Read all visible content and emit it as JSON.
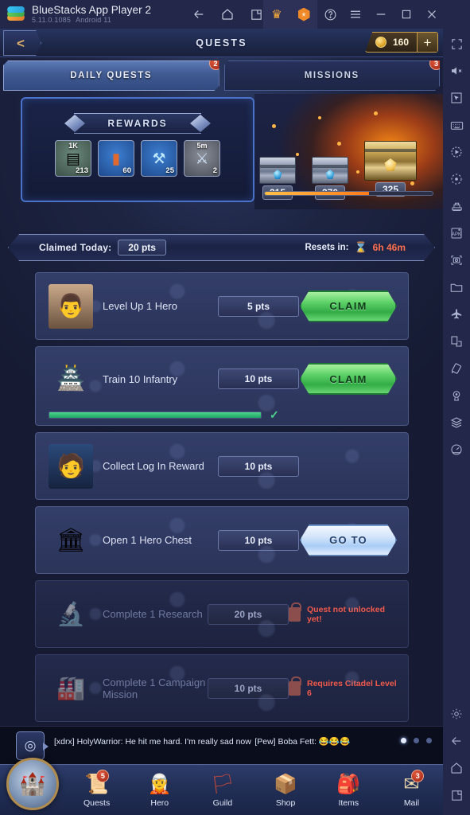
{
  "titlebar": {
    "app_name": "BlueStacks App Player 2",
    "version": "5.11.0.1085",
    "android": "Android 11",
    "nav": [
      {
        "name": "back-icon",
        "label": "Back"
      },
      {
        "name": "home-icon",
        "label": "Home"
      },
      {
        "name": "multi-instance-icon",
        "label": "Multi-instance"
      }
    ],
    "actions": [
      {
        "name": "crown-icon",
        "label": "Premium"
      },
      {
        "name": "shield-icon",
        "label": "Shield"
      },
      {
        "name": "help-icon",
        "label": "Help"
      },
      {
        "name": "menu-icon",
        "label": "Menu"
      },
      {
        "name": "minimize-icon",
        "label": "Minimize"
      },
      {
        "name": "maximize-icon",
        "label": "Maximize"
      },
      {
        "name": "close-icon",
        "label": "Close"
      },
      {
        "name": "collapse-icon",
        "label": "Collapse"
      }
    ]
  },
  "sidebar": {
    "items": [
      {
        "name": "fullscreen-icon",
        "label": "Fullscreen"
      },
      {
        "name": "mute-icon",
        "label": "Mute"
      },
      {
        "name": "cursor-icon",
        "label": "Pointer"
      },
      {
        "name": "keyboard-icon",
        "label": "Keyboard controls"
      },
      {
        "name": "macro-record-icon",
        "label": "Macro recorder"
      },
      {
        "name": "script-icon",
        "label": "Script"
      },
      {
        "name": "eco-mode-icon",
        "label": "Eco mode"
      },
      {
        "name": "install-apk-icon",
        "label": "Install APK"
      },
      {
        "name": "screenshot-icon",
        "label": "Screenshot"
      },
      {
        "name": "media-folder-icon",
        "label": "Media manager"
      },
      {
        "name": "airplane-icon",
        "label": "Game controls"
      },
      {
        "name": "rotate-icon",
        "label": "Rotate"
      },
      {
        "name": "shake-icon",
        "label": "Shake"
      },
      {
        "name": "location-icon",
        "label": "Location"
      },
      {
        "name": "layers-icon",
        "label": "Layers"
      },
      {
        "name": "gauge-icon",
        "label": "Performance"
      }
    ],
    "bottom_items": [
      {
        "name": "settings-gear-icon",
        "label": "Settings"
      },
      {
        "name": "android-back-icon",
        "label": "Back"
      },
      {
        "name": "android-home-icon",
        "label": "Home"
      },
      {
        "name": "android-recents-icon",
        "label": "Recents"
      }
    ]
  },
  "game": {
    "header": {
      "title": "QUESTS",
      "back_label": "<",
      "currency_value": "160",
      "currency_add": "+"
    },
    "tabs": [
      {
        "label": "DAILY QUESTS",
        "badge": "2",
        "active": true
      },
      {
        "label": "MISSIONS",
        "badge": "3",
        "active": false
      }
    ],
    "rewards": {
      "title": "REWARDS",
      "items": [
        {
          "name": "resource-steel",
          "top_label": "1K",
          "qty": "213",
          "glyph": "▤"
        },
        {
          "name": "speedup-item",
          "top_label": "",
          "qty": "60",
          "glyph": "▮"
        },
        {
          "name": "gem-hammer-item",
          "top_label": "",
          "qty": "25",
          "glyph": "⚒"
        },
        {
          "name": "time-booster-item",
          "top_label": "5m",
          "qty": "2",
          "glyph": "⚔"
        }
      ]
    },
    "chests": {
      "milestones": [
        "215",
        "270",
        "325"
      ],
      "progress_percent": 62
    },
    "status": {
      "claimed_label": "Claimed Today:",
      "claimed_value": "20 pts",
      "resets_label": "Resets in:",
      "resets_value": "6h 46m"
    },
    "quests": [
      {
        "name": "Level Up 1 Hero",
        "points": "5 pts",
        "action": "CLAIM",
        "action_type": "claim",
        "icon": "hero-portrait-icon",
        "glyph": "👨",
        "locked": false,
        "progress": null
      },
      {
        "name": "Train 10 Infantry",
        "points": "10 pts",
        "action": "CLAIM",
        "action_type": "claim",
        "icon": "barracks-building-icon",
        "glyph": "🏯",
        "locked": false,
        "progress": 100,
        "check": "✓"
      },
      {
        "name": "Collect Log In Reward",
        "points": "10 pts",
        "action": "",
        "action_type": "none",
        "icon": "soldier-head-icon",
        "glyph": "🧑",
        "locked": false,
        "progress": null
      },
      {
        "name": "Open 1 Hero Chest",
        "points": "10 pts",
        "action": "GO TO",
        "action_type": "goto",
        "icon": "hero-hall-building-icon",
        "glyph": "🏛",
        "locked": false,
        "progress": null
      },
      {
        "name": "Complete 1 Research",
        "points": "20 pts",
        "action": "Quest not unlocked yet!",
        "action_type": "locked",
        "icon": "research-lab-icon",
        "glyph": "🔬",
        "locked": true,
        "progress": null
      },
      {
        "name": "Complete 1 Campaign Mission",
        "points": "10 pts",
        "action": "Requires Citadel Level 6",
        "action_type": "locked",
        "icon": "campaign-base-icon",
        "glyph": "🏭",
        "locked": true,
        "progress": null
      }
    ],
    "chat": {
      "line1": "[xdrx] HolyWarrior: He hit me hard. I'm really sad now",
      "line2": "[Pew] Boba Fett: 😂😂😂",
      "avatar_icon": "location-pin-icon"
    },
    "bottomnav": {
      "citadel_label": "Citadel",
      "citadel_glyph": "🏰",
      "items": [
        {
          "label": "Quests",
          "badge": "5",
          "glyph": "📜",
          "name": "nav-quests"
        },
        {
          "label": "Hero",
          "badge": "",
          "glyph": "🧝",
          "name": "nav-hero"
        },
        {
          "label": "Guild",
          "badge": "",
          "glyph": "🏳",
          "name": "nav-guild"
        },
        {
          "label": "Shop",
          "badge": "",
          "glyph": "📦",
          "name": "nav-shop"
        },
        {
          "label": "Items",
          "badge": "",
          "glyph": "🎒",
          "name": "nav-items"
        },
        {
          "label": "Mail",
          "badge": "3",
          "glyph": "✉",
          "name": "nav-mail"
        }
      ]
    }
  },
  "colors": {
    "accent_blue": "#4a72c9",
    "claim_green": "#5fd269",
    "goto_blue": "#a9ccf6",
    "locked_red": "#f2594a",
    "gold": "#c9a14e",
    "badge_red": "#9e2414"
  }
}
